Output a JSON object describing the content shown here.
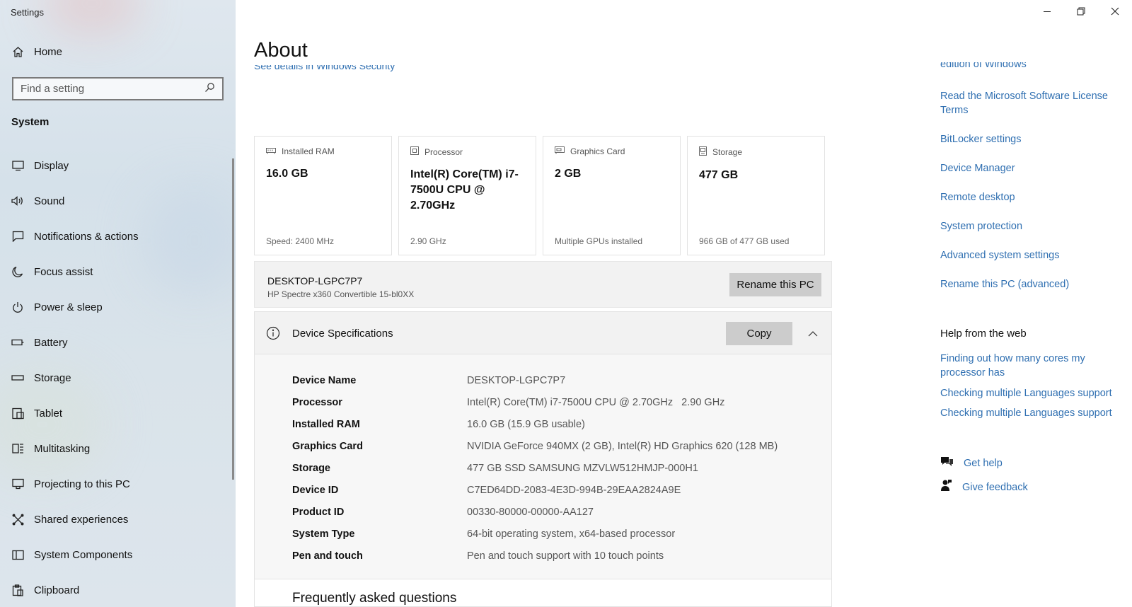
{
  "window": {
    "title": "Settings",
    "controls": [
      "minimize-icon",
      "restore-icon",
      "close-icon"
    ]
  },
  "sidebar": {
    "home_label": "Home",
    "search_placeholder": "Find a setting",
    "section_title": "System",
    "items": [
      {
        "label": "Display",
        "icon": "display-icon"
      },
      {
        "label": "Sound",
        "icon": "sound-icon"
      },
      {
        "label": "Notifications & actions",
        "icon": "notifications-icon"
      },
      {
        "label": "Focus assist",
        "icon": "moon-icon"
      },
      {
        "label": "Power & sleep",
        "icon": "power-icon"
      },
      {
        "label": "Battery",
        "icon": "battery-icon"
      },
      {
        "label": "Storage",
        "icon": "storage-icon"
      },
      {
        "label": "Tablet",
        "icon": "tablet-icon"
      },
      {
        "label": "Multitasking",
        "icon": "multitasking-icon"
      },
      {
        "label": "Projecting to this PC",
        "icon": "projecting-icon"
      },
      {
        "label": "Shared experiences",
        "icon": "shared-icon"
      },
      {
        "label": "System Components",
        "icon": "components-icon"
      },
      {
        "label": "Clipboard",
        "icon": "clipboard-icon"
      }
    ]
  },
  "main": {
    "title": "About",
    "cut_link": "See details in Windows Security",
    "cards": [
      {
        "label": "Installed RAM",
        "value": "16.0 GB",
        "sub": "Speed: 2400 MHz",
        "icon": "ram-icon"
      },
      {
        "label": "Processor",
        "value": "Intel(R) Core(TM) i7-7500U CPU @ 2.70GHz",
        "sub": "2.90 GHz",
        "icon": "processor-icon"
      },
      {
        "label": "Graphics Card",
        "value": "2 GB",
        "sub": "Multiple GPUs installed",
        "icon": "graphics-icon"
      },
      {
        "label": "Storage",
        "value": "477 GB",
        "sub": "966 GB of 477 GB used",
        "icon": "storage-card-icon"
      }
    ],
    "pc": {
      "name": "DESKTOP-LGPC7P7",
      "model": "HP Spectre x360 Convertible 15-bl0XX",
      "rename_label": "Rename this PC"
    },
    "specs": {
      "title": "Device Specifications",
      "copy_label": "Copy",
      "rows": [
        {
          "label": "Device Name",
          "value": "DESKTOP-LGPC7P7"
        },
        {
          "label": "Processor",
          "value": "Intel(R) Core(TM) i7-7500U CPU @ 2.70GHz   2.90 GHz"
        },
        {
          "label": "Installed RAM",
          "value": "16.0 GB (15.9 GB usable)"
        },
        {
          "label": "Graphics Card",
          "value": "NVIDIA GeForce 940MX (2 GB), Intel(R) HD Graphics 620 (128 MB)"
        },
        {
          "label": "Storage",
          "value": "477 GB SSD SAMSUNG MZVLW512HMJP-000H1"
        },
        {
          "label": "Device ID",
          "value": "C7ED64DD-2083-4E3D-994B-29EAA2824A9E"
        },
        {
          "label": "Product ID",
          "value": "00330-80000-00000-AA127"
        },
        {
          "label": "System Type",
          "value": "64-bit operating system, x64-based processor"
        },
        {
          "label": "Pen and touch",
          "value": "Pen and touch support with 10 touch points"
        }
      ],
      "faq_title": "Frequently asked questions"
    }
  },
  "right": {
    "cut_link": "edition of Windows",
    "links": [
      "Read the Microsoft Software License Terms",
      "BitLocker settings",
      "Device Manager",
      "Remote desktop",
      "System protection",
      "Advanced system settings",
      "Rename this PC (advanced)"
    ],
    "help_title": "Help from the web",
    "help_links": [
      "Finding out how many cores my processor has",
      "Checking multiple Languages support",
      "Checking multiple Languages support"
    ],
    "get_help": "Get help",
    "give_feedback": "Give feedback"
  },
  "colors": {
    "link": "#2f6fb1",
    "button": "#cccccc",
    "panel": "#f2f2f2"
  }
}
